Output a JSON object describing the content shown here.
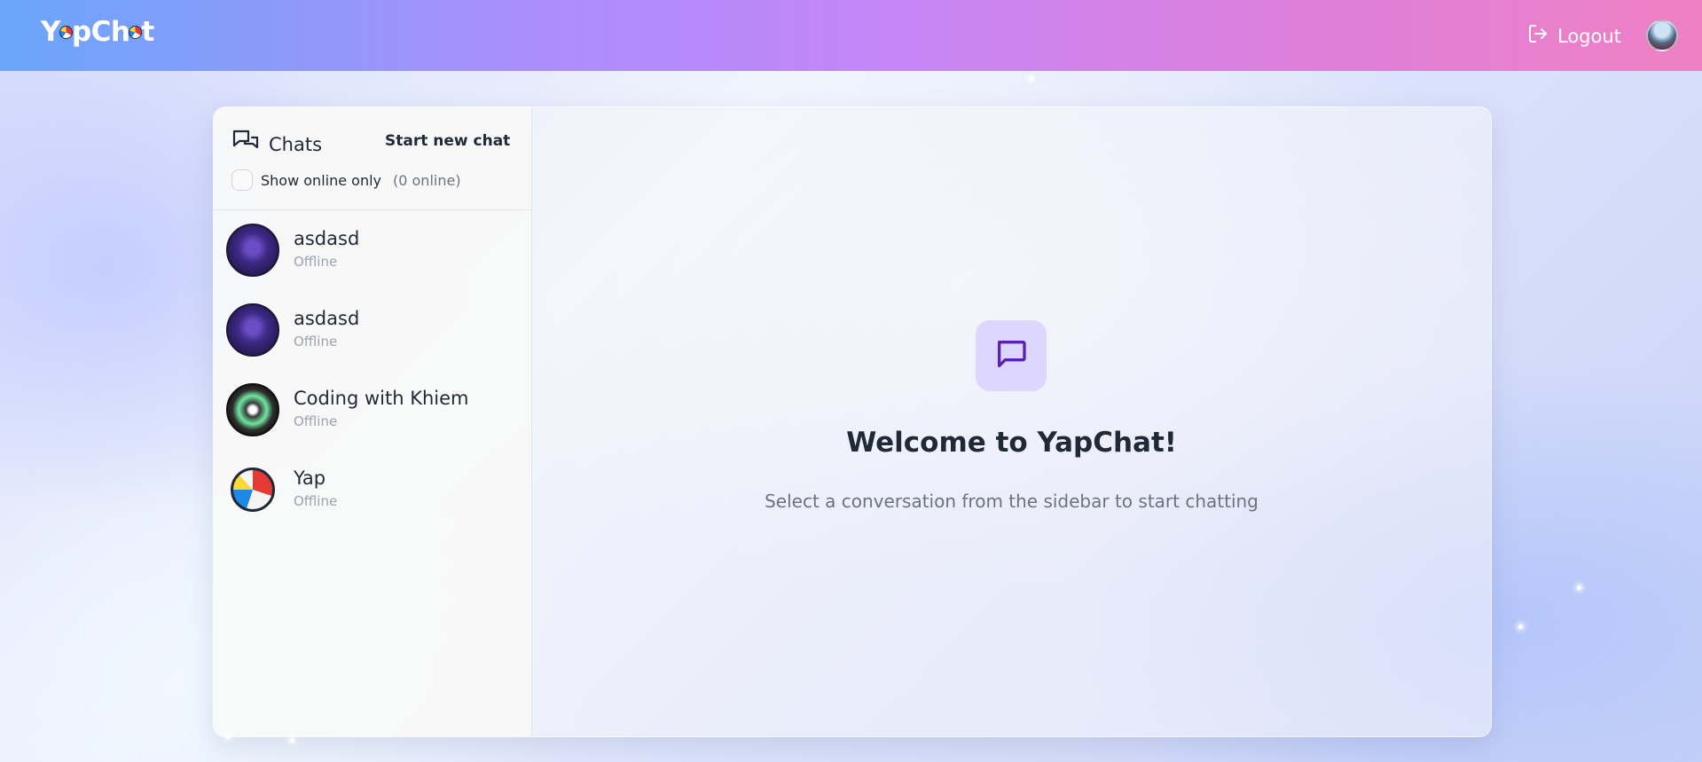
{
  "app": {
    "logo_text_a": "Y",
    "logo_text_b": "pCh",
    "logo_text_c": "t",
    "logout_label": "Logout"
  },
  "sidebar": {
    "title": "Chats",
    "new_chat_label": "Start new chat",
    "online_filter_label": "Show online only",
    "online_count": "(0 online)",
    "items": [
      {
        "name": "asdasd",
        "status": "Offline",
        "avatar": "wizard-avatar"
      },
      {
        "name": "asdasd",
        "status": "Offline",
        "avatar": "wizard-avatar"
      },
      {
        "name": "Coding with Khiem",
        "status": "Offline",
        "avatar": "coding-avatar"
      },
      {
        "name": "Yap",
        "status": "Offline",
        "avatar": "beach-ball-avatar"
      }
    ]
  },
  "main": {
    "welcome_title": "Welcome to YapChat!",
    "welcome_subtitle": "Select a conversation from the sidebar to start chatting",
    "icon": "message-bubble-icon"
  },
  "colors": {
    "header_gradient_start": "#6aa6fb",
    "header_gradient_mid": "#c286f8",
    "header_gradient_end": "#ef80c4",
    "accent": "#5b21b6",
    "icon_tile": "#ddd6fe"
  }
}
